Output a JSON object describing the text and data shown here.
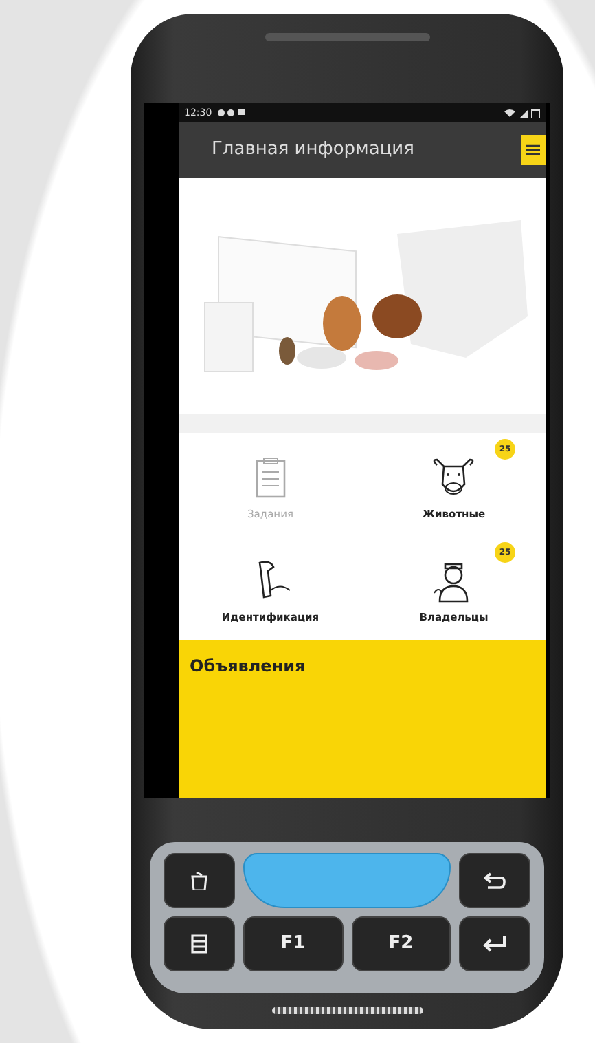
{
  "status_bar": {
    "time": "12:30"
  },
  "app_bar": {
    "title": "Главная информация"
  },
  "tiles": [
    {
      "kind": "tasks",
      "label": "Задания",
      "disabled": true
    },
    {
      "kind": "animals",
      "label": "Животные",
      "disabled": false,
      "badge": "25"
    },
    {
      "kind": "identification",
      "label": "Идентификация",
      "disabled": false
    },
    {
      "kind": "owners",
      "label": "Владельцы",
      "disabled": false,
      "badge": "25"
    }
  ],
  "announcements": {
    "title": "Объявления"
  },
  "keypad": {
    "keys": [
      "F1",
      "F2"
    ]
  }
}
